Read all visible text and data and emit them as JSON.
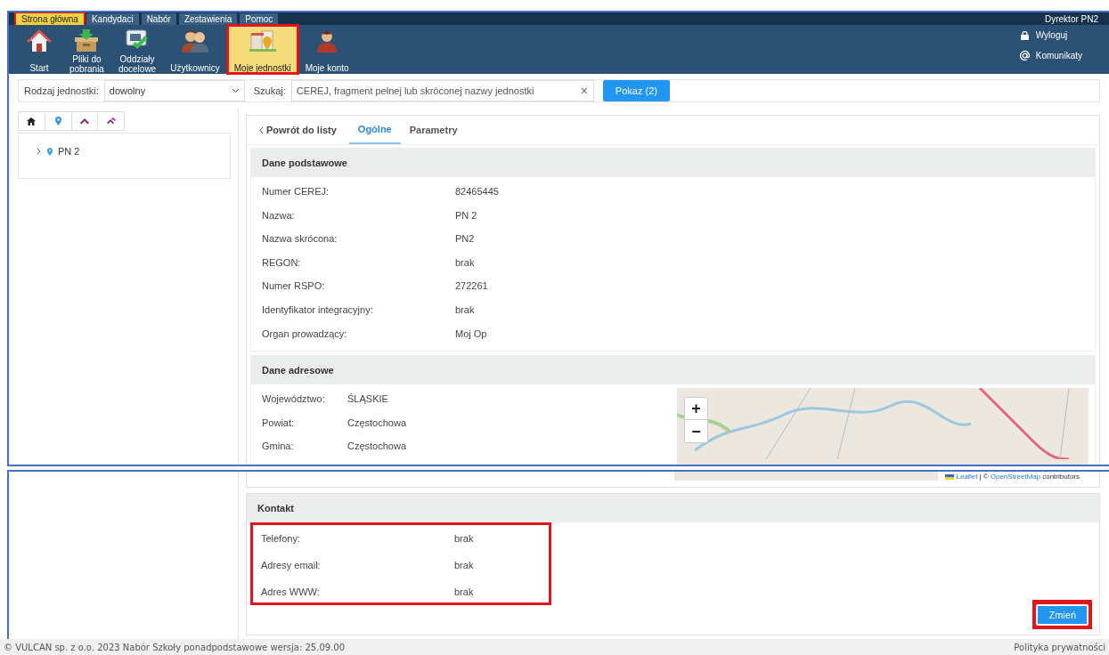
{
  "menu_tabs": [
    {
      "label": "Strona główna",
      "selected": true,
      "annotated": true
    },
    {
      "label": "Kandydaci",
      "selected": false,
      "annotated": false
    },
    {
      "label": "Nabór",
      "selected": false,
      "annotated": false
    },
    {
      "label": "Zestawienia",
      "selected": false,
      "annotated": false
    },
    {
      "label": "Pomoc",
      "selected": false,
      "annotated": false
    }
  ],
  "user": "Dyrektor PN2",
  "toolbar": [
    {
      "lines": [
        "Start"
      ],
      "selected": false,
      "annotated": false
    },
    {
      "lines": [
        "Pliki do",
        "pobrania"
      ],
      "selected": false,
      "annotated": false
    },
    {
      "lines": [
        "Oddziały",
        "docelowe"
      ],
      "selected": false,
      "annotated": false
    },
    {
      "lines": [
        "Użytkownicy"
      ],
      "selected": false,
      "annotated": false
    },
    {
      "lines": [
        "Moje jednostki"
      ],
      "selected": true,
      "annotated": true
    },
    {
      "lines": [
        "Moje konto"
      ],
      "selected": false,
      "annotated": false
    }
  ],
  "user_links": [
    {
      "label": "Wyloguj"
    },
    {
      "label": "Komunikaty"
    }
  ],
  "filter": {
    "type_label": "Rodzaj jednostki:",
    "type_value": "dowolny",
    "search_label": "Szukaj:",
    "search_placeholder": "CEREJ, fragment pełnej lub skróconej nazwy jednostki",
    "clear": "×",
    "show_button": "Pokaz (2)"
  },
  "tree": [
    {
      "label": "PN 2",
      "expanded": false
    }
  ],
  "detail_tabs": [
    {
      "label": "Powrót do listy",
      "kind": "back",
      "selected": false
    },
    {
      "label": "Ogólne",
      "kind": "tab",
      "selected": true
    },
    {
      "label": "Parametry",
      "kind": "tab",
      "selected": false
    }
  ],
  "basic": {
    "title": "Dane podstawowe",
    "rows": [
      {
        "label": "Numer CEREJ:",
        "value": "82465445"
      },
      {
        "label": "Nazwa:",
        "value": "PN 2"
      },
      {
        "label": "Nazwa skrócona:",
        "value": "PN2"
      },
      {
        "label": "REGON:",
        "value": "brak"
      },
      {
        "label": "Numer RSPO:",
        "value": "272261"
      },
      {
        "label": "Identyfikator integracyjny:",
        "value": "brak"
      },
      {
        "label": "Organ prowadzący:",
        "value": "Moj Op"
      }
    ]
  },
  "address": {
    "title": "Dane adresowe",
    "rows": [
      {
        "label": "Województwo:",
        "value": "ŚLĄSKIE"
      },
      {
        "label": "Powiat:",
        "value": "Częstochowa"
      },
      {
        "label": "Gmina:",
        "value": "Częstochowa"
      }
    ],
    "zoom_in": "+",
    "zoom_out": "−",
    "attribution": {
      "leaflet": "Leaflet",
      "separator": "| ©",
      "osm": "OpenStreetMap",
      "rest": "contributors"
    }
  },
  "contact": {
    "title": "Kontakt",
    "annotated": true,
    "rows": [
      {
        "label": "Telefony:",
        "value": "brak"
      },
      {
        "label": "Adresy email:",
        "value": "brak"
      },
      {
        "label": "Adres WWW:",
        "value": "brak"
      }
    ]
  },
  "change_button": {
    "label": "Zmień",
    "annotated": true
  },
  "footer": {
    "text": "© VULCAN sp. z o.o. 2023 Nabór Szkoły ponadpodstawowe wersja: 25.09.00",
    "privacy": "Polityka prywatności"
  }
}
